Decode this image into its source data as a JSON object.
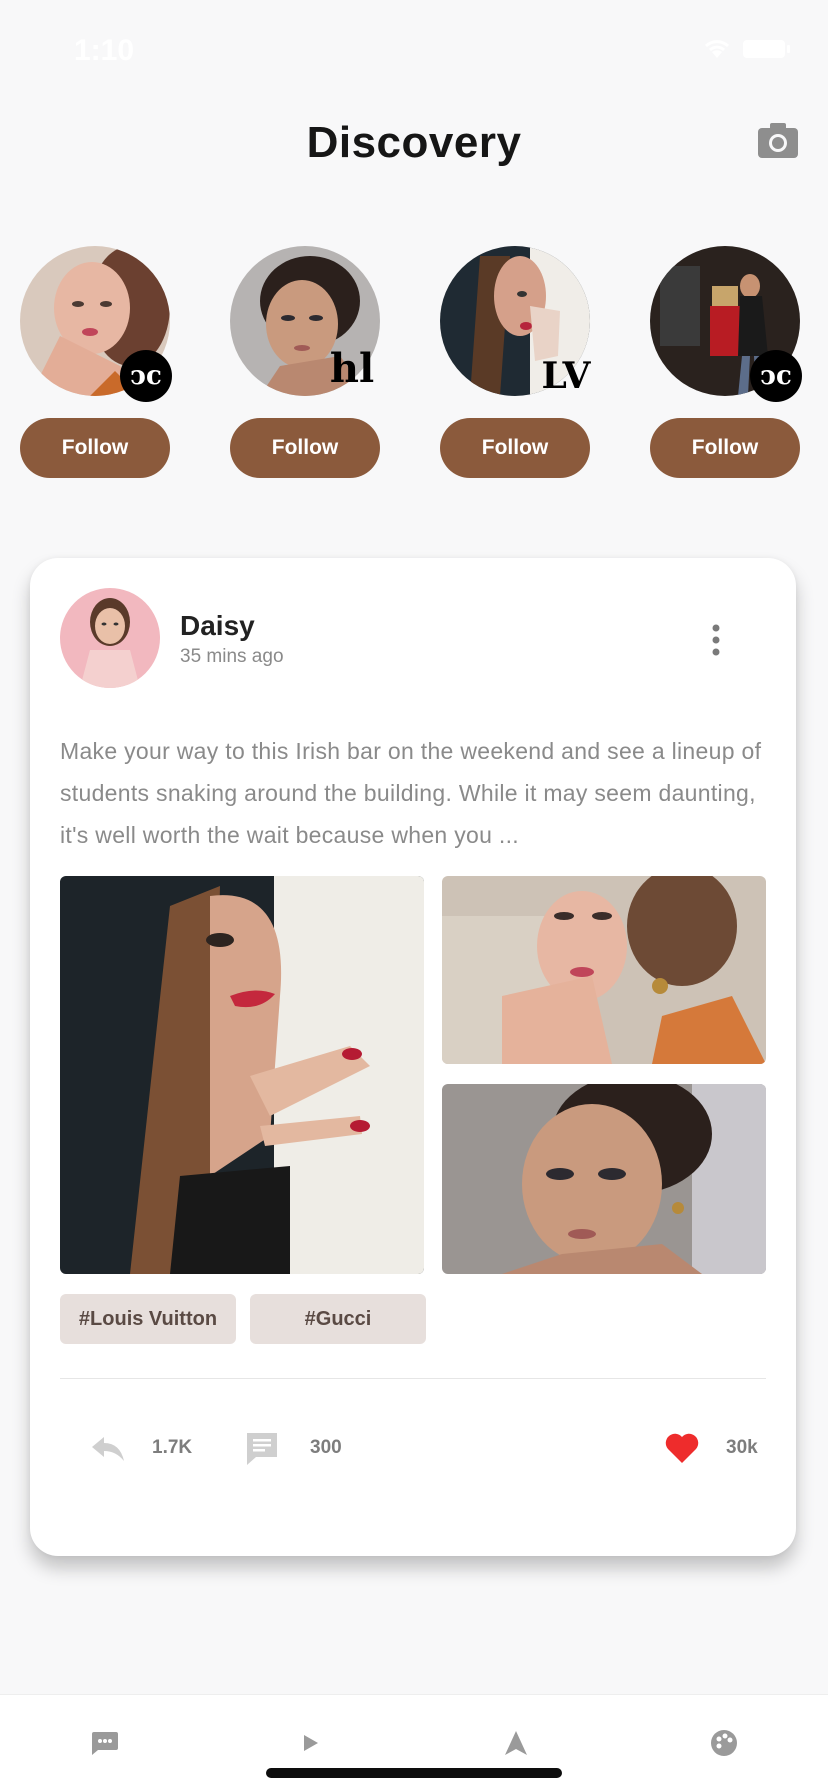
{
  "status_bar": {
    "time": "1:10"
  },
  "header": {
    "title": "Discovery",
    "camera_icon": "camera-icon"
  },
  "stories": [
    {
      "follow_label": "Follow",
      "badge": "ↄc",
      "badge_icon": "chanel-logo-icon",
      "skin": "#e7b7a3",
      "hair": "#6b4030",
      "bg": "#d9c9bd"
    },
    {
      "follow_label": "Follow",
      "badge": "hl",
      "badge_icon": "brand-logo-icon",
      "skin": "#c99a7e",
      "hair": "#2b201c",
      "bg": "#b6b3b2"
    },
    {
      "follow_label": "Follow",
      "badge": "LV",
      "badge_icon": "louis-vuitton-logo-icon",
      "skin": "#d5a08a",
      "hair": "#5a3a26",
      "bg": "#f0ede8"
    },
    {
      "follow_label": "Follow",
      "badge": "ↄc",
      "badge_icon": "chanel-logo-icon",
      "skin": "#c79272",
      "hair": "#b0884a",
      "bg": "#2a221e"
    }
  ],
  "post": {
    "author": "Daisy",
    "time": "35 mins ago",
    "text": "Make your way to this Irish bar on the weekend and see a lineup of students snaking around the building. While it may seem daunting, it's well worth the wait because when you ...",
    "tags": [
      "#Louis Vuitton",
      "#Gucci"
    ],
    "shares": "1.7K",
    "comments": "300",
    "likes": "30k",
    "like_color": "#ee2c2c"
  },
  "colors": {
    "accent": "#8b5a3c",
    "tag_bg": "#e7dfdc"
  },
  "bottom_nav": [
    "chat-icon",
    "play-icon",
    "navigate-icon",
    "palette-icon"
  ]
}
